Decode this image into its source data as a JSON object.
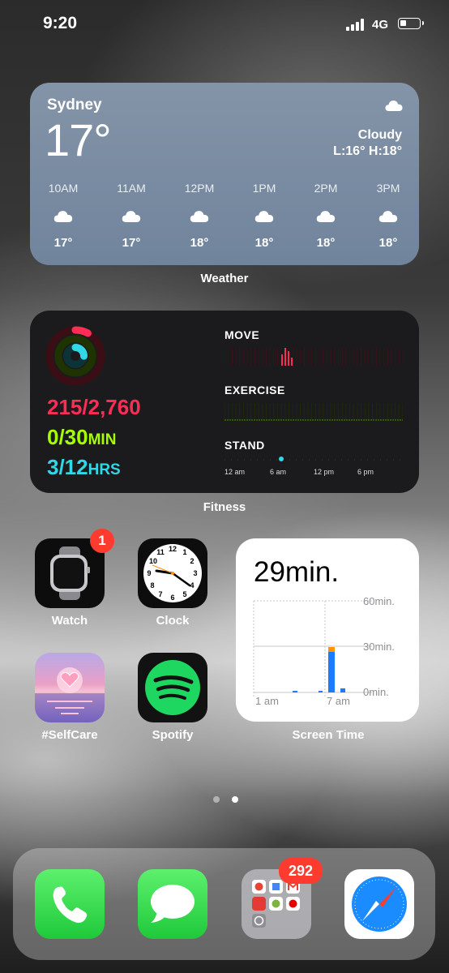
{
  "status_bar": {
    "time": "9:20",
    "network": "4G"
  },
  "weather": {
    "widget_label": "Weather",
    "city": "Sydney",
    "temperature": "17°",
    "condition": "Cloudy",
    "low_high": "L:16° H:18°",
    "icon": "cloud-icon",
    "hourly": [
      {
        "time": "10AM",
        "temp": "17°"
      },
      {
        "time": "11AM",
        "temp": "17°"
      },
      {
        "time": "12PM",
        "temp": "18°"
      },
      {
        "time": "1PM",
        "temp": "18°"
      },
      {
        "time": "2PM",
        "temp": "18°"
      },
      {
        "time": "3PM",
        "temp": "18°"
      }
    ]
  },
  "fitness": {
    "widget_label": "Fitness",
    "move_value": "215/2,760",
    "exercise_value": "0/30",
    "exercise_unit": "MIN",
    "stand_value": "3/12",
    "stand_unit": "HRS",
    "move_label": "MOVE",
    "exercise_label": "EXERCISE",
    "stand_label": "STAND",
    "time_ticks": [
      "12 am",
      "6 am",
      "12 pm",
      "6 pm"
    ],
    "colors": {
      "move": "#ff2d55",
      "exercise": "#a6ff00",
      "stand": "#32d7e6"
    },
    "move_ring_fraction": 0.08,
    "exercise_ring_fraction": 0.0,
    "stand_ring_fraction": 0.25
  },
  "apps": {
    "watch": {
      "label": "Watch",
      "badge": "1",
      "icon": "watch-icon"
    },
    "clock": {
      "label": "Clock",
      "icon": "clock-icon"
    },
    "selfcare": {
      "label": "#SelfCare",
      "icon": "heart-sunset-icon"
    },
    "spotify": {
      "label": "Spotify",
      "icon": "spotify-icon"
    }
  },
  "screen_time": {
    "widget_label": "Screen Time",
    "total": "29min.",
    "y_ticks": [
      "60min.",
      "30min.",
      "0min."
    ],
    "x_ticks": [
      "1 am",
      "7 am"
    ]
  },
  "dock": {
    "folder_badge": "292",
    "apps": [
      "phone-icon",
      "messages-icon",
      "app-folder-icon",
      "safari-icon"
    ]
  }
}
